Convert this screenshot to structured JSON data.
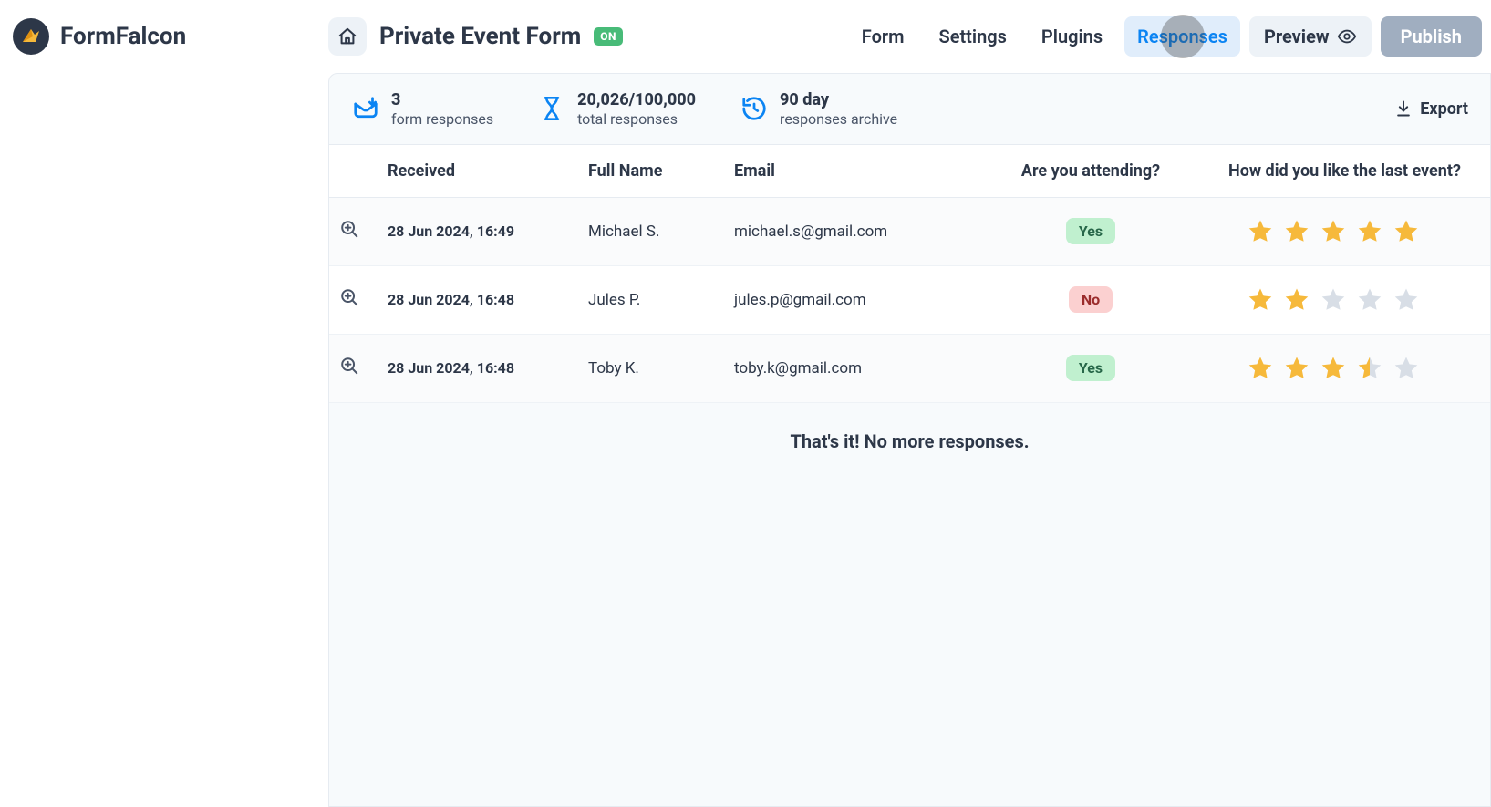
{
  "brand": {
    "name": "FormFalcon"
  },
  "header": {
    "title": "Private Event Form",
    "status_badge": "ON",
    "nav": [
      {
        "key": "form",
        "label": "Form",
        "active": false
      },
      {
        "key": "settings",
        "label": "Settings",
        "active": false
      },
      {
        "key": "plugins",
        "label": "Plugins",
        "active": false
      },
      {
        "key": "responses",
        "label": "Responses",
        "active": true
      }
    ],
    "preview_label": "Preview",
    "publish_label": "Publish"
  },
  "summary": {
    "form_responses": {
      "value": "3",
      "label": "form responses"
    },
    "total_responses": {
      "value": "20,026/100,000",
      "label": "total responses"
    },
    "archive": {
      "value": "90 day",
      "label": "responses archive"
    },
    "export_label": "Export"
  },
  "table": {
    "columns": {
      "received": "Received",
      "full_name": "Full Name",
      "email": "Email",
      "attending": "Are you attending?",
      "rating": "How did you like the last event?"
    },
    "rows": [
      {
        "received": "28 Jun 2024, 16:49",
        "full_name": "Michael S.",
        "email": "michael.s@gmail.com",
        "attending": "Yes",
        "rating": 5
      },
      {
        "received": "28 Jun 2024, 16:48",
        "full_name": "Jules P.",
        "email": "jules.p@gmail.com",
        "attending": "No",
        "rating": 2
      },
      {
        "received": "28 Jun 2024, 16:48",
        "full_name": "Toby K.",
        "email": "toby.k@gmail.com",
        "attending": "Yes",
        "rating": 3.5
      }
    ],
    "end_message": "That's it! No more responses."
  },
  "colors": {
    "accent": "#0b84f3",
    "star_filled": "#f6b93b",
    "star_empty": "#d8dee6",
    "yes_bg": "#c0f0cf",
    "no_bg": "#fbd0d0"
  }
}
